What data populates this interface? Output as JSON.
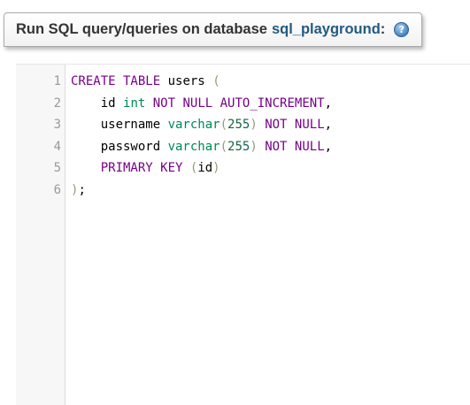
{
  "header": {
    "title": "Run SQL query/queries on database",
    "database": "sql_playground",
    "colon": ":",
    "help_icon": "help-icon"
  },
  "editor": {
    "lines": [
      {
        "number": "1",
        "tokens": [
          {
            "t": "CREATE TABLE",
            "c": "kw"
          },
          {
            "t": " ",
            "c": "pl"
          },
          {
            "t": "users",
            "c": "pl"
          },
          {
            "t": " ",
            "c": "pl"
          },
          {
            "t": "(",
            "c": "br"
          }
        ]
      },
      {
        "number": "2",
        "tokens": [
          {
            "t": "    id ",
            "c": "pl"
          },
          {
            "t": "int",
            "c": "ty"
          },
          {
            "t": " ",
            "c": "pl"
          },
          {
            "t": "NOT NULL AUTO_INCREMENT",
            "c": "kw"
          },
          {
            "t": ",",
            "c": "pl"
          }
        ]
      },
      {
        "number": "3",
        "tokens": [
          {
            "t": "    username ",
            "c": "pl"
          },
          {
            "t": "varchar",
            "c": "ty"
          },
          {
            "t": "(",
            "c": "br"
          },
          {
            "t": "255",
            "c": "nm"
          },
          {
            "t": ")",
            "c": "br"
          },
          {
            "t": " ",
            "c": "pl"
          },
          {
            "t": "NOT NULL",
            "c": "kw"
          },
          {
            "t": ",",
            "c": "pl"
          }
        ]
      },
      {
        "number": "4",
        "tokens": [
          {
            "t": "    password ",
            "c": "pl"
          },
          {
            "t": "varchar",
            "c": "ty"
          },
          {
            "t": "(",
            "c": "br"
          },
          {
            "t": "255",
            "c": "nm"
          },
          {
            "t": ")",
            "c": "br"
          },
          {
            "t": " ",
            "c": "pl"
          },
          {
            "t": "NOT NULL",
            "c": "kw"
          },
          {
            "t": ",",
            "c": "pl"
          }
        ]
      },
      {
        "number": "5",
        "tokens": [
          {
            "t": "    ",
            "c": "pl"
          },
          {
            "t": "PRIMARY KEY",
            "c": "kw"
          },
          {
            "t": " ",
            "c": "pl"
          },
          {
            "t": "(",
            "c": "br"
          },
          {
            "t": "id",
            "c": "pl"
          },
          {
            "t": ")",
            "c": "br"
          }
        ]
      },
      {
        "number": "6",
        "tokens": [
          {
            "t": ")",
            "c": "br"
          },
          {
            "t": ";",
            "c": "pl"
          }
        ]
      }
    ]
  },
  "colors": {
    "keyword": "#770088",
    "type": "#008855",
    "number": "#116644",
    "bracket": "#999977",
    "link": "#235a81"
  }
}
